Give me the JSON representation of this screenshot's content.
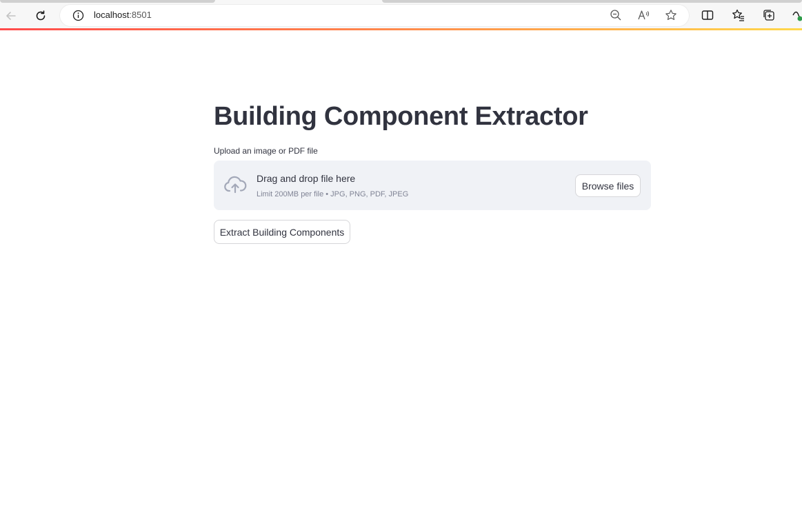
{
  "browser": {
    "url_host": "localhost",
    "url_port": ":8501",
    "icons": [
      "back-icon",
      "refresh-icon",
      "site-info-icon",
      "zoom-out-icon",
      "read-aloud-icon",
      "favorite-star-icon",
      "split-screen-icon",
      "favorites-icon",
      "collections-icon",
      "extensions-icon"
    ],
    "accent_gradient": [
      "#ff4b4b",
      "#ff8a4b",
      "#ffd84b"
    ]
  },
  "app": {
    "title": "Building Component Extractor",
    "uploader": {
      "label": "Upload an image or PDF file",
      "drop_text": "Drag and drop file here",
      "limit_text": "Limit 200MB per file • JPG, PNG, PDF, JPEG",
      "browse_label": "Browse files"
    },
    "extract_button_label": "Extract Building Components"
  },
  "colors": {
    "text": "#31333f",
    "dropzone_bg": "#f0f2f6",
    "muted_text": "#808495",
    "cloud_icon": "#a3a8b8"
  }
}
